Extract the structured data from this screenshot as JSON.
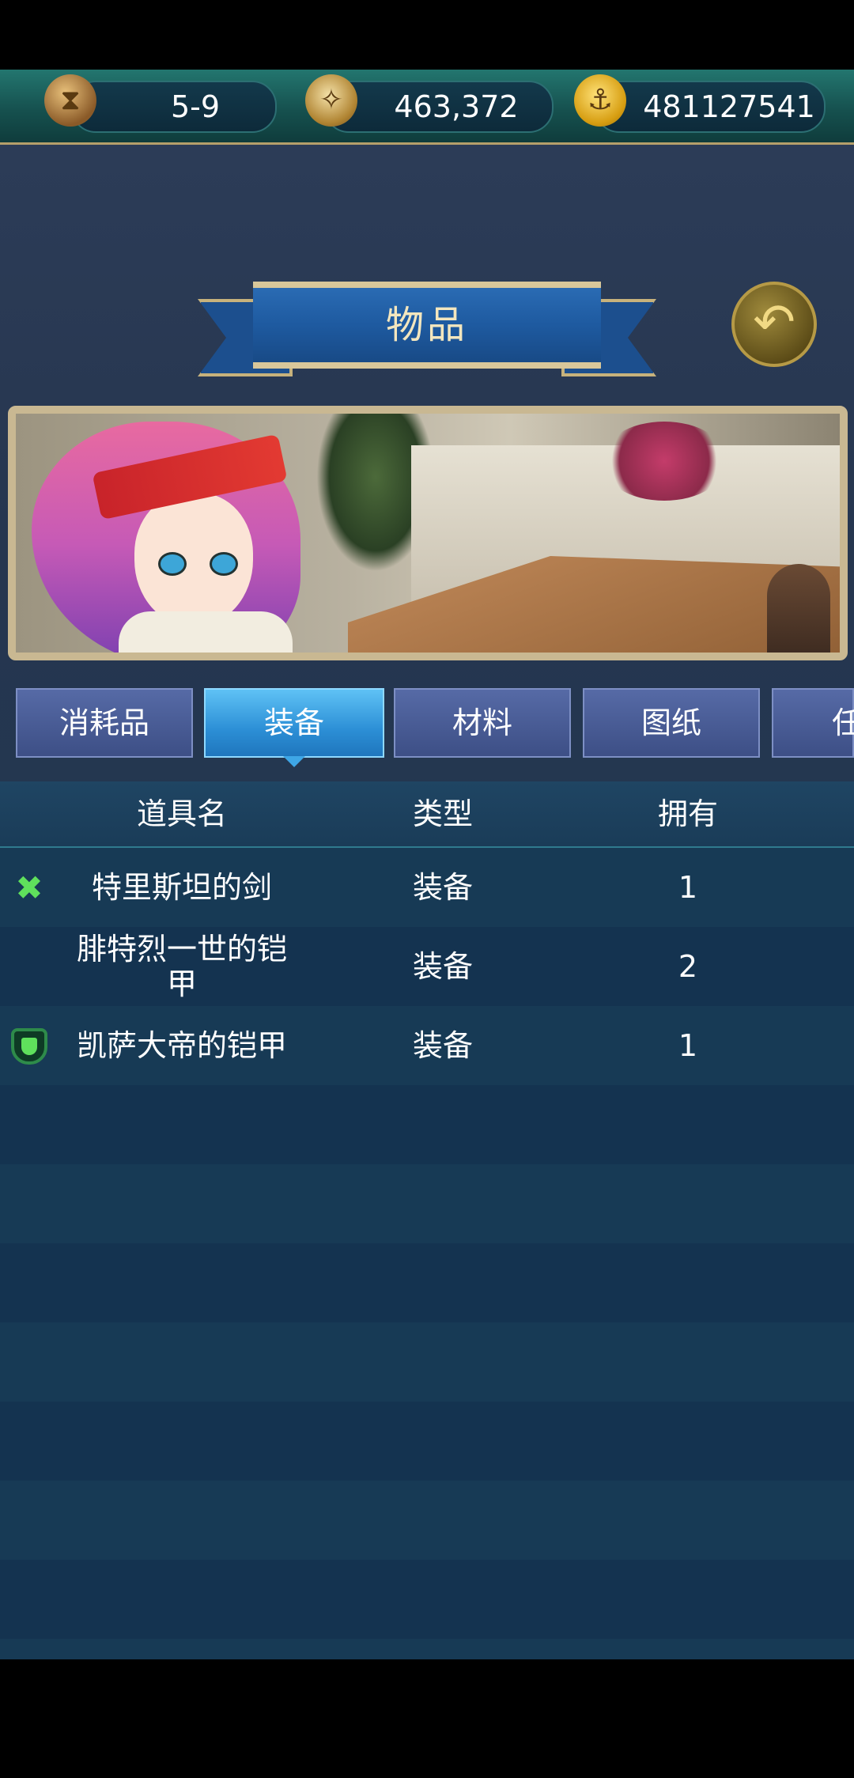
{
  "status": {
    "stage": "5-9",
    "compass_value": "463,372",
    "gold_value": "481127541"
  },
  "header": {
    "title": "物品",
    "back_icon": "back-arrow-icon"
  },
  "tabs": [
    {
      "label": "消耗品",
      "active": false
    },
    {
      "label": "装备",
      "active": true
    },
    {
      "label": "材料",
      "active": false
    },
    {
      "label": "图纸",
      "active": false
    },
    {
      "label": "任",
      "active": false
    }
  ],
  "table": {
    "columns": [
      "道具名",
      "类型",
      "拥有"
    ],
    "rows": [
      {
        "name": "特里斯坦的剑",
        "type": "装备",
        "count": "1",
        "icon": "crossed-swords-icon"
      },
      {
        "name": "腓特烈一世的铠甲",
        "type": "装备",
        "count": "2",
        "icon": ""
      },
      {
        "name": "凯萨大帝的铠甲",
        "type": "装备",
        "count": "1",
        "icon": "shield-icon"
      }
    ]
  },
  "colors": {
    "accent": "#2c8fd6",
    "banner": "#1e5aa0",
    "icon_green": "#5fe05c"
  }
}
